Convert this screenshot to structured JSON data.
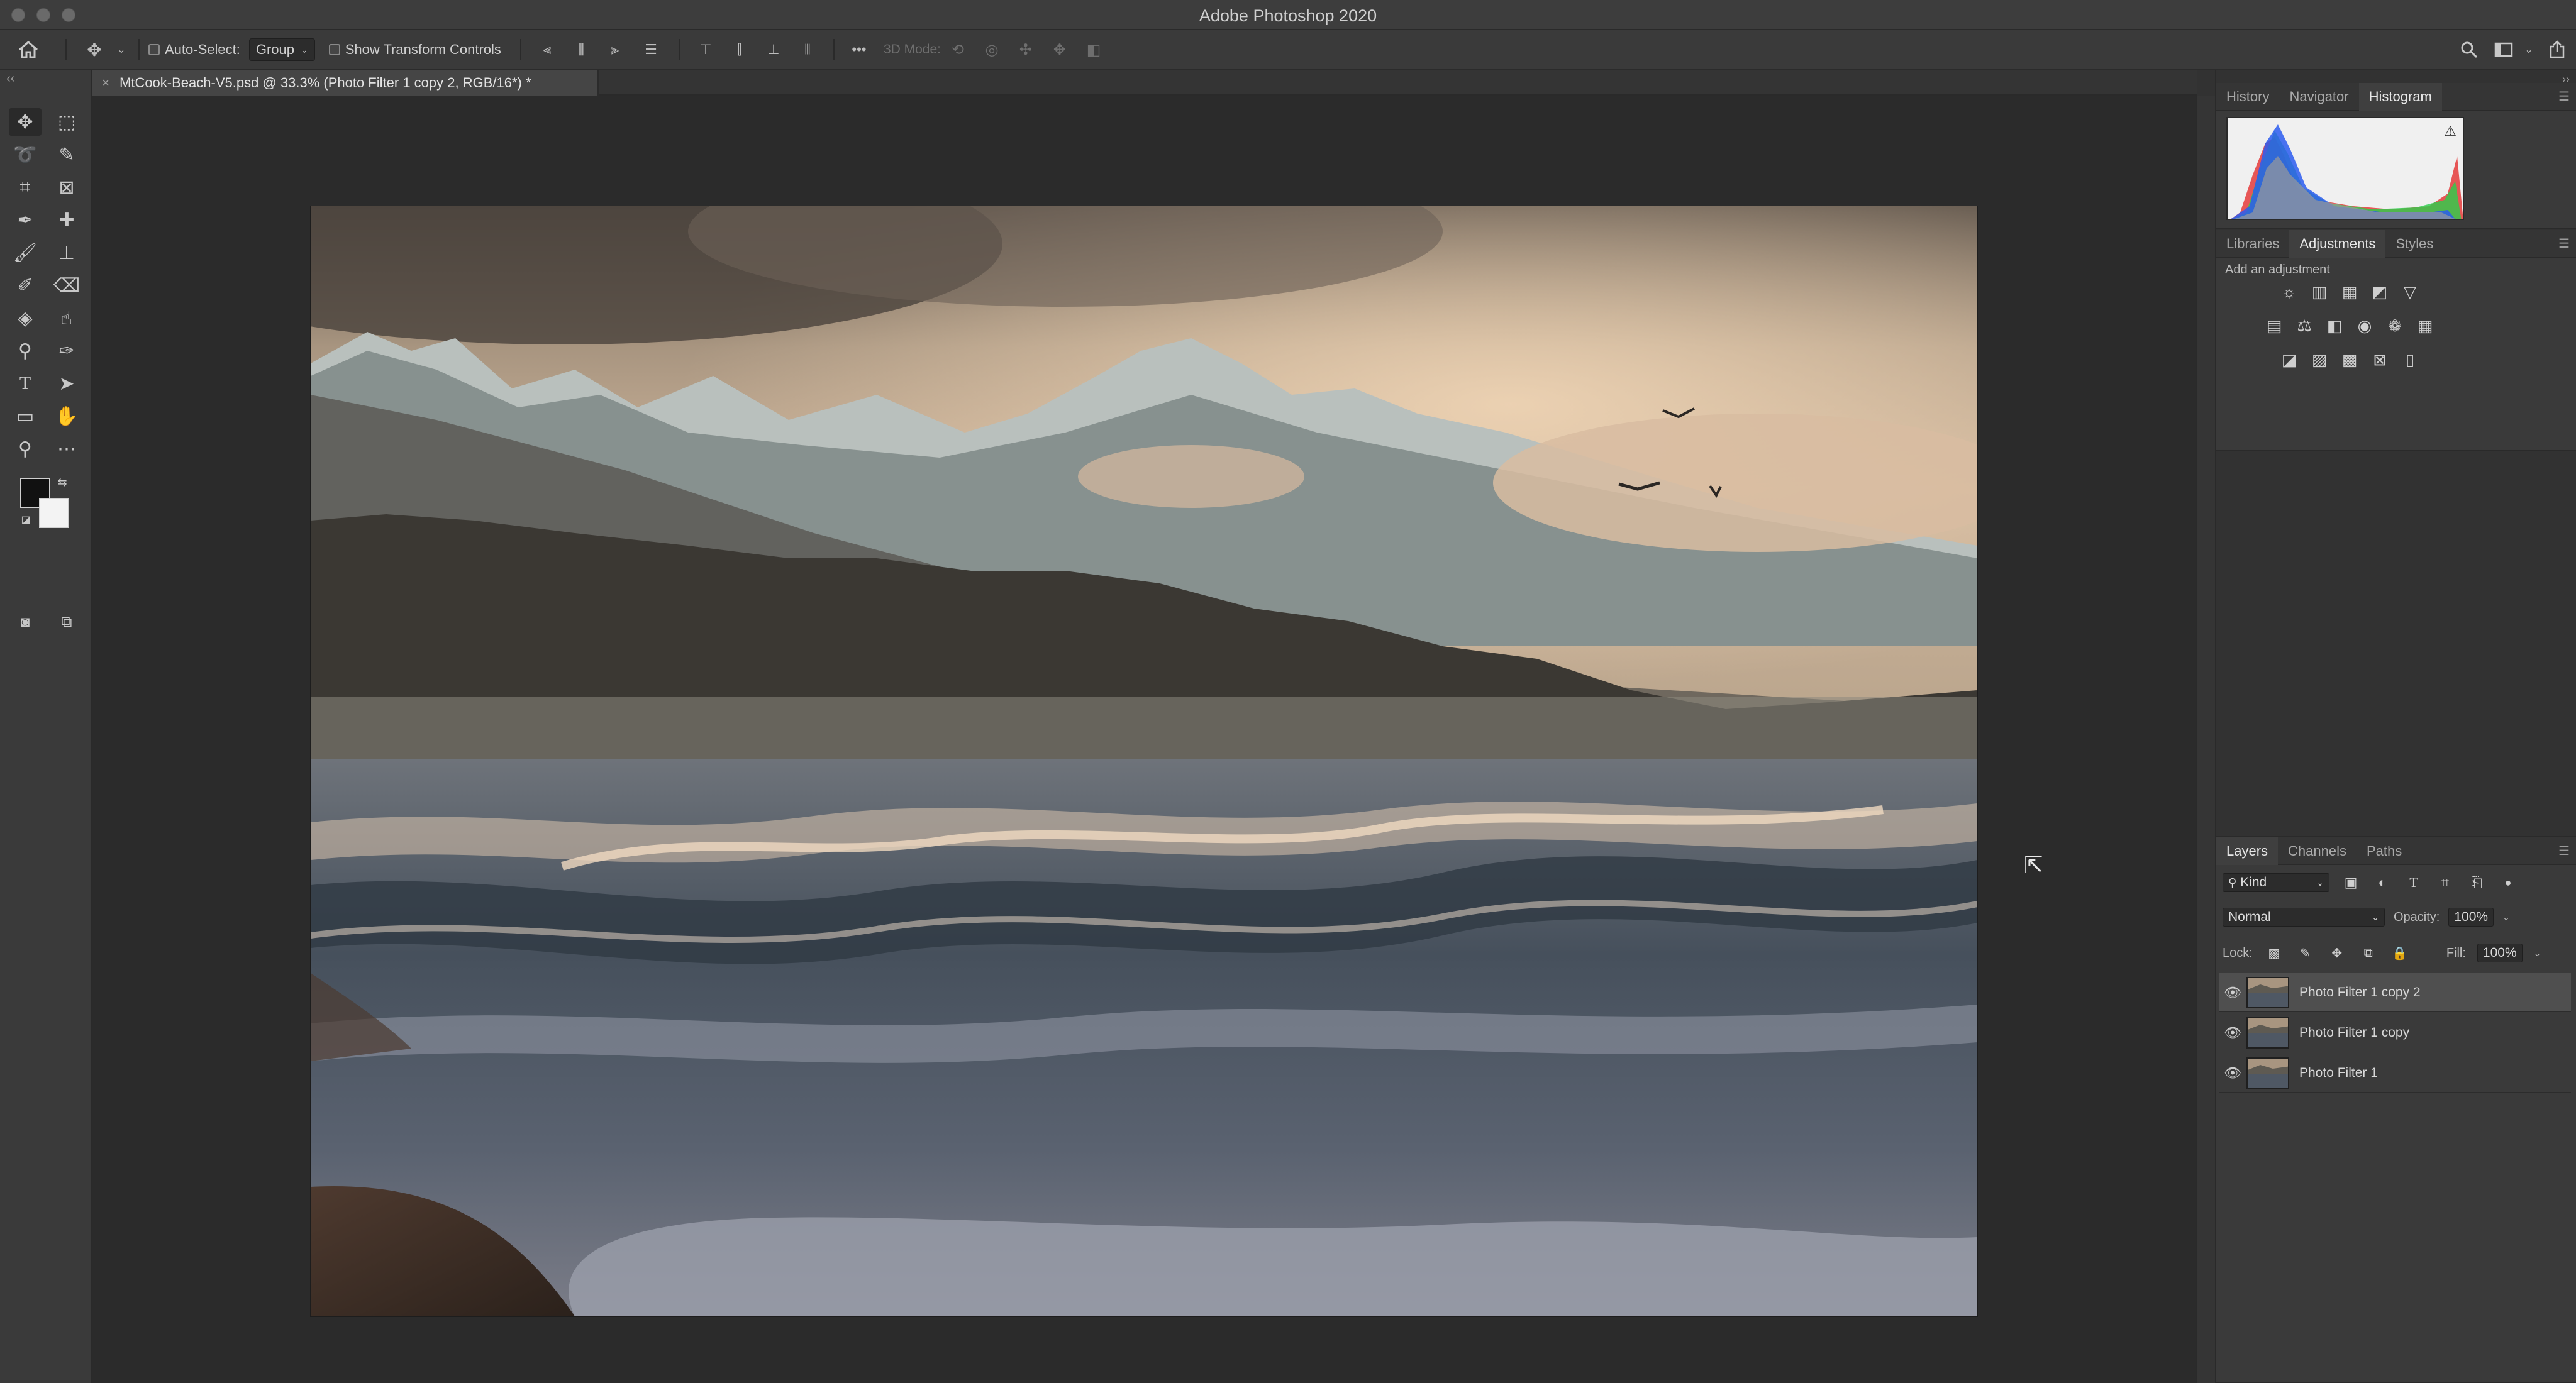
{
  "app": {
    "window_title": "Adobe Photoshop 2020"
  },
  "options_bar": {
    "auto_select_label": "Auto-Select:",
    "auto_select_value": "Group",
    "show_transform_label": "Show Transform Controls",
    "mode_3d_label": "3D Mode:",
    "more_label": "•••"
  },
  "document": {
    "tab_title": "MtCook-Beach-V5.psd @ 33.3% (Photo Filter 1 copy 2, RGB/16*) *",
    "close_glyph": "×"
  },
  "panels": {
    "top_tabs": [
      "History",
      "Navigator",
      "Histogram"
    ],
    "top_active": "Histogram",
    "mid_tabs": [
      "Libraries",
      "Adjustments",
      "Styles"
    ],
    "mid_active": "Adjustments",
    "add_adjustment_label": "Add an adjustment",
    "layers_tabs": [
      "Layers",
      "Channels",
      "Paths"
    ],
    "layers_active": "Layers"
  },
  "layers": {
    "filter_kind": "Kind",
    "blend_mode": "Normal",
    "opacity_label": "Opacity:",
    "opacity_value": "100%",
    "lock_label": "Lock:",
    "fill_label": "Fill:",
    "fill_value": "100%",
    "items": [
      {
        "name": "Photo Filter 1 copy 2",
        "selected": true
      },
      {
        "name": "Photo Filter 1 copy",
        "selected": false
      },
      {
        "name": "Photo Filter 1",
        "selected": false
      }
    ]
  },
  "colors": {
    "foreground": "#111111",
    "background": "#f3f3f3",
    "accent_selected": "#4f4f4f"
  },
  "icons": {
    "home": "home-icon",
    "move": "move-icon",
    "search": "search-icon",
    "workspace": "workspace-icon",
    "share": "share-icon",
    "warning": "warning-icon"
  }
}
